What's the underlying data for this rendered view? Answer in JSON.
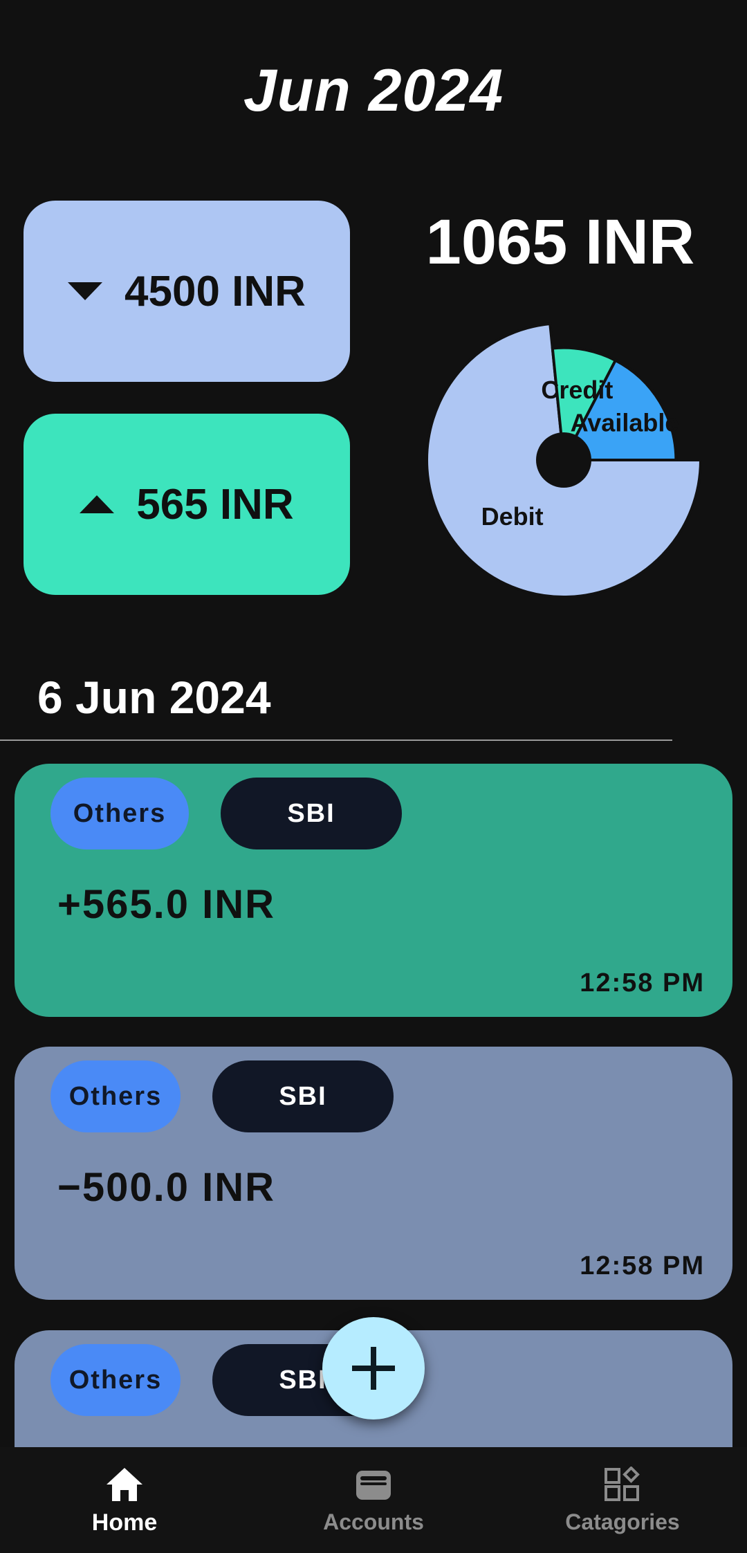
{
  "header": {
    "month": "Jun 2024"
  },
  "summary": {
    "debit_total": "4500 INR",
    "credit_total": "565 INR",
    "balance": "1065 INR"
  },
  "chart_data": {
    "type": "pie",
    "style": "donut",
    "slices": [
      {
        "label": "Debit",
        "value": 4500,
        "color": "#aec6f3"
      },
      {
        "label": "Credit",
        "value": 565,
        "color": "#3de4bd"
      },
      {
        "label": "Available",
        "value": 1065,
        "color": "#3aa3f6"
      }
    ]
  },
  "day_group": {
    "date": "6 Jun 2024"
  },
  "transactions": [
    {
      "category": "Others",
      "account": "SBI",
      "amount": "565.0 INR",
      "sign": "+",
      "time": "12:58 PM",
      "kind": "credit",
      "bg": "#30a88c"
    },
    {
      "category": "Others",
      "account": "SBI",
      "amount": "500.0 INR",
      "sign": "−",
      "time": "12:58 PM",
      "kind": "debit",
      "bg": "#7b8eb0"
    },
    {
      "category": "Others",
      "account": "SBI"
    }
  ],
  "bottom_nav": {
    "items": [
      {
        "label": "Home",
        "icon": "home-icon",
        "active": true
      },
      {
        "label": "Accounts",
        "icon": "wallet-icon",
        "active": false
      },
      {
        "label": "Catagories",
        "icon": "categories-icon",
        "active": false
      }
    ]
  },
  "fab": {
    "icon": "plus-icon"
  }
}
